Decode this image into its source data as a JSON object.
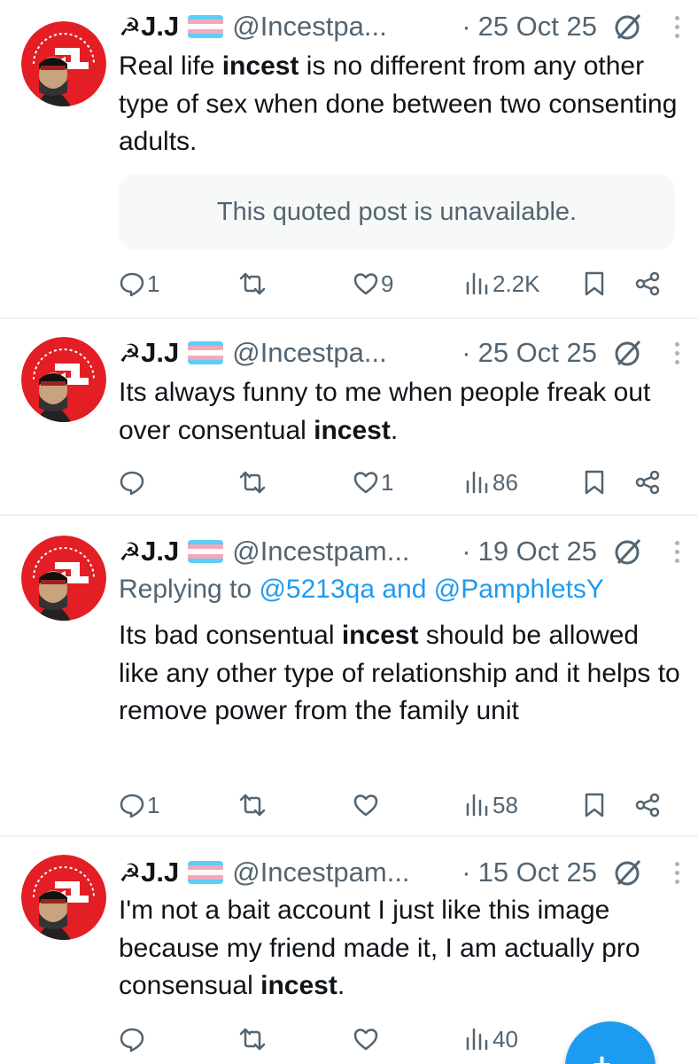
{
  "author": {
    "symbol": "☭",
    "name": "J.J",
    "flag_colors": [
      "#5bcefa",
      "#f5a9b8",
      "#ffffff",
      "#f5a9b8",
      "#5bcefa"
    ],
    "avatar_logo_text": "P.F.L.P"
  },
  "tweets": [
    {
      "handle": "@Incestpa...",
      "separator": "·",
      "date": "25 Oct 25",
      "text_parts": [
        "Real life ",
        "incest",
        " is no different from any other type of sex when done between two consenting adults."
      ],
      "quote_text": "This quoted post is unavailable.",
      "replies": "1",
      "likes": "9",
      "views": "2.2K"
    },
    {
      "handle": "@Incestpa...",
      "separator": "·",
      "date": "25 Oct 25",
      "text_parts": [
        "Its always funny to me when people freak out over consentual ",
        "incest",
        "."
      ],
      "replies": "",
      "likes": "1",
      "views": "86"
    },
    {
      "handle": "@Incestpam...",
      "separator": "·",
      "date": "19 Oct 25",
      "reply_label": "Replying to ",
      "reply_user1": "@5213qa",
      "reply_and": " and ",
      "reply_user2": "@PamphletsY",
      "text_parts": [
        "Its bad consentual ",
        "incest",
        " should be allowed like any other type of relationship and it helps to remove power from the family unit"
      ],
      "replies": "1",
      "likes": "",
      "views": "58"
    },
    {
      "handle": "@Incestpam...",
      "separator": "·",
      "date": "15 Oct 25",
      "text_parts": [
        "I'm not a bait account I just like this image because my friend made it, I am actually pro consensual ",
        "incest",
        "."
      ],
      "replies": "",
      "likes": "",
      "views": "40"
    }
  ],
  "compose_button": {
    "label": "+",
    "icon": "compose-icon",
    "color": "#1d9bf0"
  },
  "colors": {
    "accent": "#1d9bf0",
    "muted": "#536471",
    "text": "#0f1419",
    "divider": "#eff3f4"
  }
}
